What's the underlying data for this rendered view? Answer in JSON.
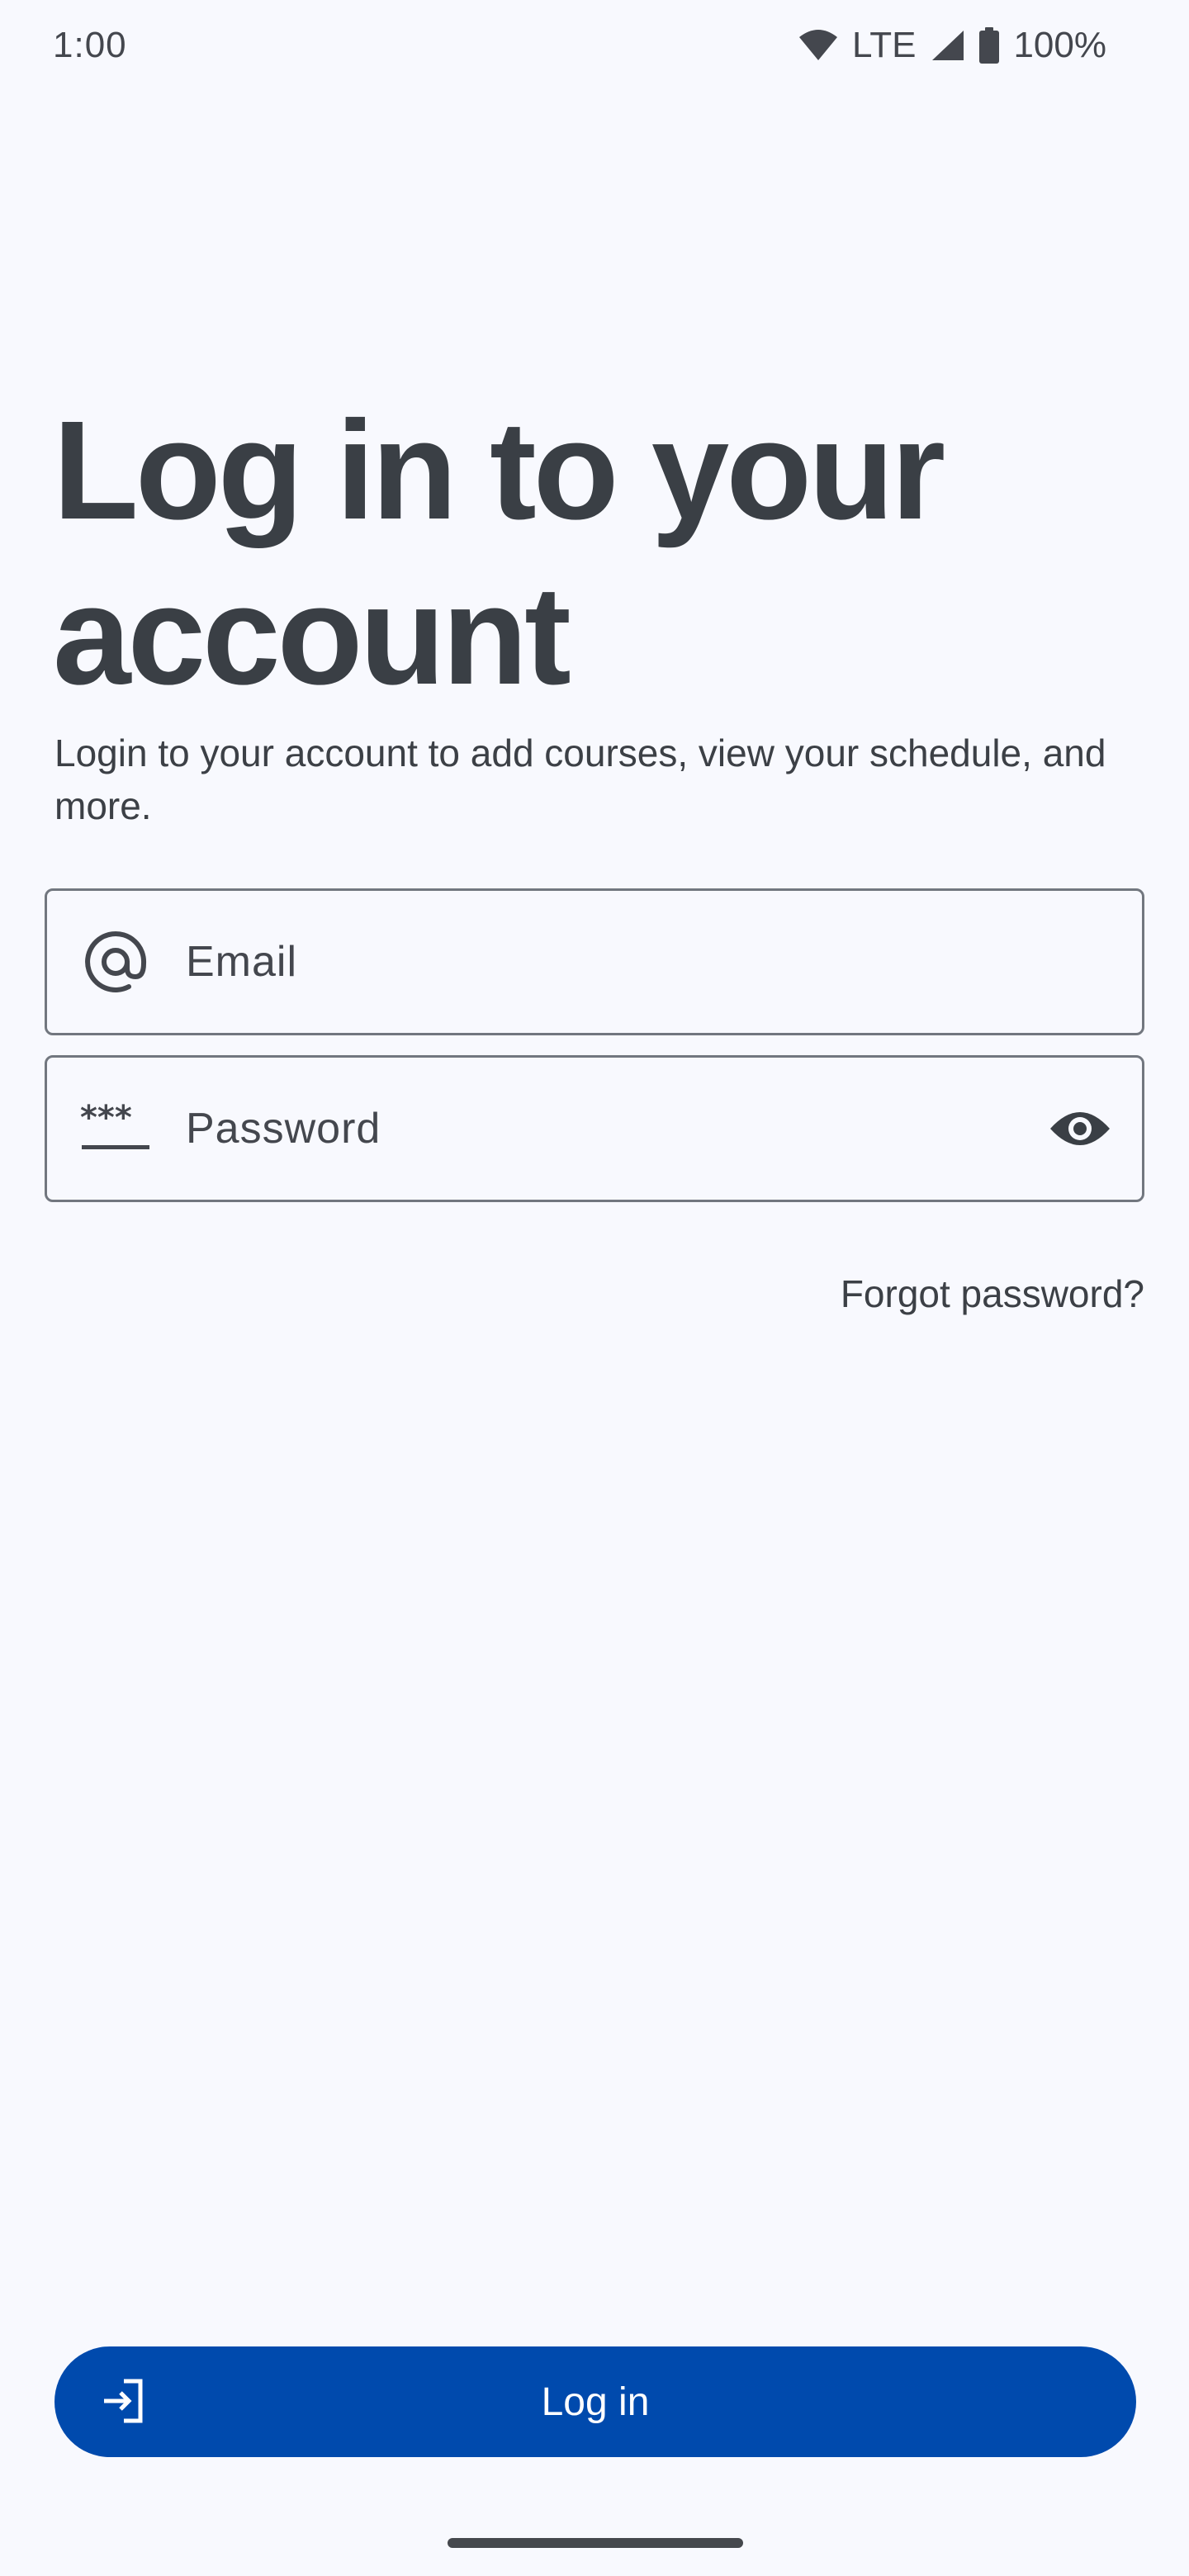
{
  "status_bar": {
    "time": "1:00",
    "network": "LTE",
    "battery": "100%",
    "icons": [
      "wifi-icon",
      "cell-signal-icon",
      "battery-icon"
    ]
  },
  "header": {
    "title": "Log in to your account",
    "subtitle": "Login to your account to add courses, view your schedule, and more."
  },
  "form": {
    "email": {
      "placeholder": "Email",
      "icon": "at-sign-icon"
    },
    "password": {
      "placeholder": "Password",
      "icon": "password-icon",
      "toggle_icon": "eye-icon"
    },
    "forgot_password": "Forgot password?"
  },
  "login_button": {
    "label": "Log in",
    "icon": "login-icon"
  },
  "colors": {
    "background": "#f8f9fe",
    "primary": "#004aad",
    "text": "#42474e",
    "outline": "#72777f"
  }
}
